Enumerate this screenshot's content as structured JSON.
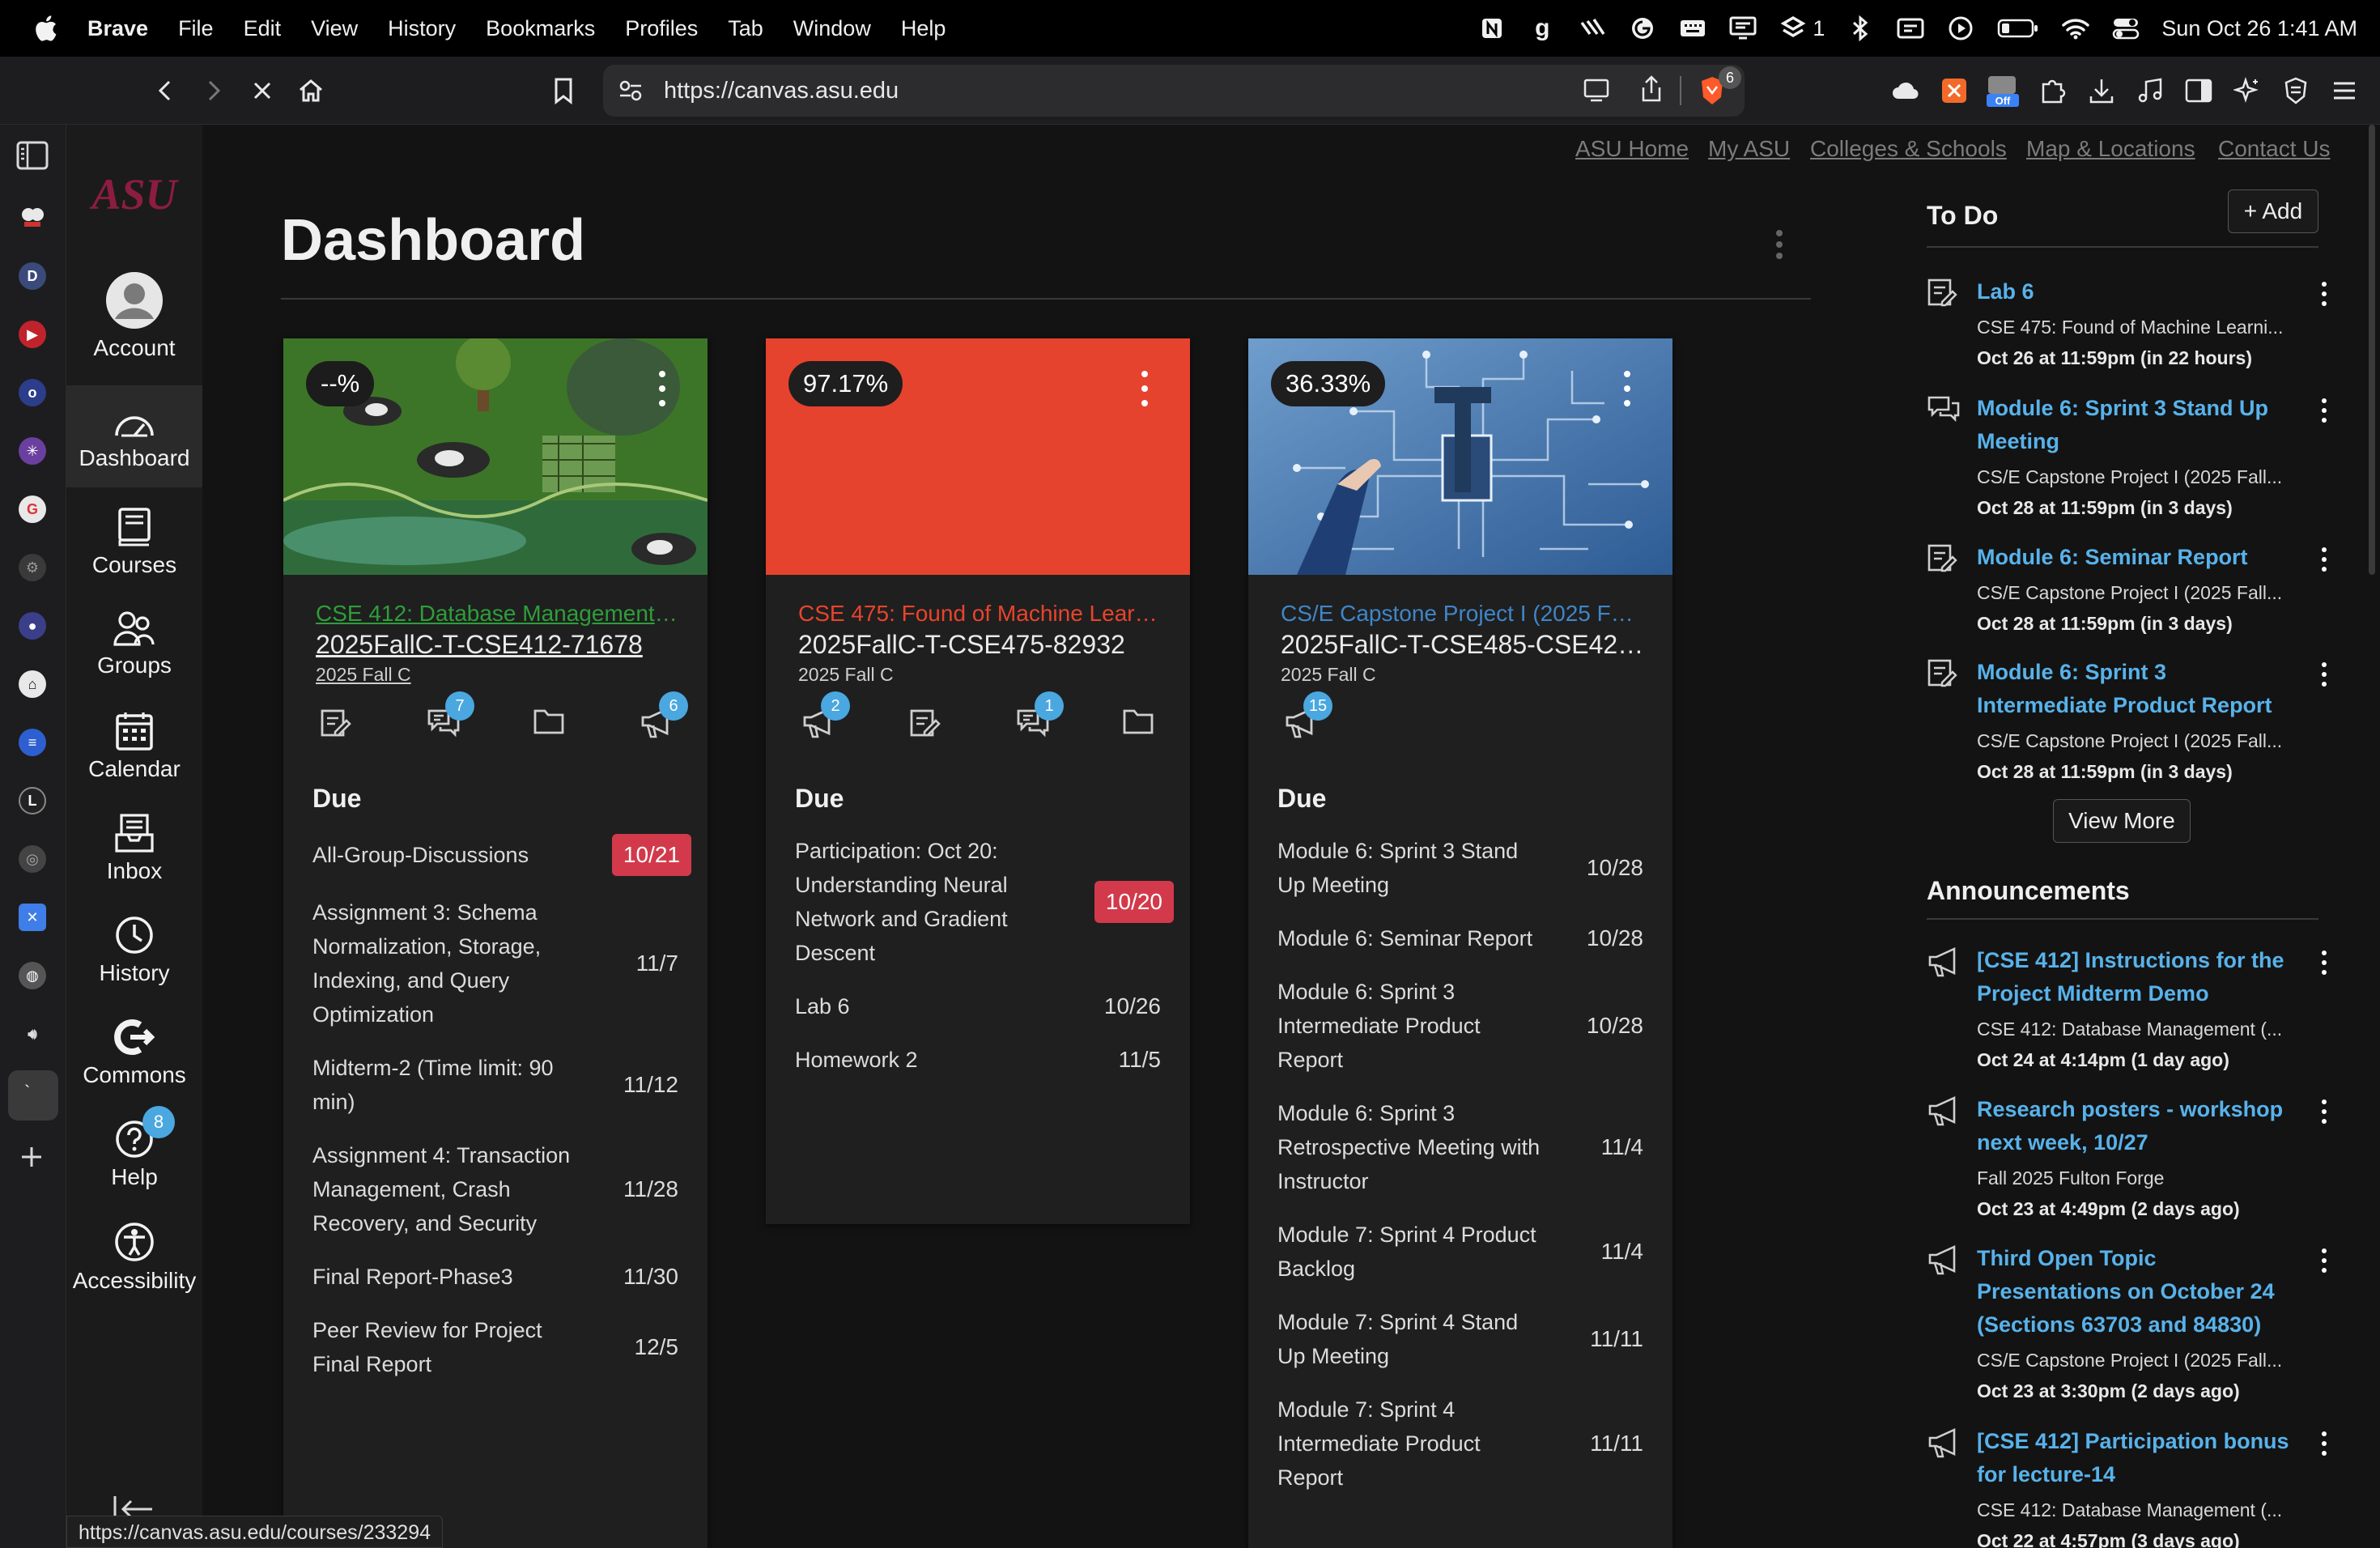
{
  "menubar": {
    "app": "Brave",
    "items": [
      "File",
      "Edit",
      "View",
      "History",
      "Bookmarks",
      "Profiles",
      "Tab",
      "Window",
      "Help"
    ],
    "status_number": "1",
    "clock": "Sun Oct 26  1:41 AM"
  },
  "toolbar": {
    "url": "https://canvas.asu.edu",
    "shields_count": "6",
    "off_badge": "Off"
  },
  "logo": {
    "text": "ASU",
    "color": "#8c1d40"
  },
  "gnav": {
    "items": [
      {
        "label": "Account",
        "icon": "account-avatar-icon"
      },
      {
        "label": "Dashboard",
        "icon": "dashboard-gauge-icon"
      },
      {
        "label": "Courses",
        "icon": "courses-book-icon"
      },
      {
        "label": "Groups",
        "icon": "groups-people-icon"
      },
      {
        "label": "Calendar",
        "icon": "calendar-icon"
      },
      {
        "label": "Inbox",
        "icon": "inbox-icon"
      },
      {
        "label": "History",
        "icon": "history-clock-icon"
      },
      {
        "label": "Commons",
        "icon": "commons-icon"
      },
      {
        "label": "Help",
        "icon": "help-icon",
        "badge": "8"
      },
      {
        "label": "Accessibility",
        "icon": "accessibility-icon"
      }
    ]
  },
  "top_links": [
    "ASU Home",
    "My ASU",
    "Colleges & Schools",
    "Map & Locations",
    "Contact Us"
  ],
  "page_title": "Dashboard",
  "cards": [
    {
      "grade": "--%",
      "title": "CSE 412: Database Management (...",
      "title_color": "#2e9e3a",
      "code": "2025FallC-T-CSE412-71678",
      "term": "2025 Fall C",
      "icons": [
        {
          "name": "assignments-icon",
          "badge": ""
        },
        {
          "name": "discussions-icon",
          "badge": "7"
        },
        {
          "name": "files-icon",
          "badge": ""
        },
        {
          "name": "announcements-icon",
          "badge": "6"
        }
      ],
      "due_heading": "Due",
      "due": [
        {
          "name": "All-Group-Discussions",
          "date": "10/21",
          "late": true
        },
        {
          "name": "Assignment 3: Schema Normalization, Storage, Indexing, and Query Optimization",
          "date": "11/7",
          "late": false
        },
        {
          "name": "Midterm-2 (Time limit: 90 min)",
          "date": "11/12",
          "late": false
        },
        {
          "name": "Assignment 4: Transaction Management, Crash Recovery, and Security",
          "date": "11/28",
          "late": false
        },
        {
          "name": "Final Report-Phase3",
          "date": "11/30",
          "late": false
        },
        {
          "name": "Peer Review for Project Final Report",
          "date": "12/5",
          "late": false
        }
      ]
    },
    {
      "grade": "97.17%",
      "title": "CSE 475: Found of Machine Learn...",
      "title_color": "#e8442c",
      "hero_color": "#e5432d",
      "code": "2025FallC-T-CSE475-82932",
      "term": "2025 Fall C",
      "icons": [
        {
          "name": "announcements-icon",
          "badge": "2"
        },
        {
          "name": "assignments-icon",
          "badge": ""
        },
        {
          "name": "discussions-icon",
          "badge": "1"
        },
        {
          "name": "files-icon",
          "badge": ""
        }
      ],
      "due_heading": "Due",
      "due": [
        {
          "name": "Participation: Oct 20: Understanding Neural Network and Gradient Descent",
          "date": "10/20",
          "late": true
        },
        {
          "name": "Lab 6",
          "date": "10/26",
          "late": false
        },
        {
          "name": "Homework 2",
          "date": "11/5",
          "late": false
        }
      ]
    },
    {
      "grade": "36.33%",
      "title": "CS/E Capstone Project I (2025 Fal...",
      "title_color": "#3f86c8",
      "code": "2025FallC-T-CSE485-CSE423-...",
      "term": "2025 Fall C",
      "icons": [
        {
          "name": "announcements-icon",
          "badge": "15"
        }
      ],
      "due_heading": "Due",
      "due": [
        {
          "name": "Module 6: Sprint 3 Stand Up Meeting",
          "date": "10/28",
          "late": false
        },
        {
          "name": "Module 6: Seminar Report",
          "date": "10/28",
          "late": false
        },
        {
          "name": "Module 6: Sprint 3 Intermediate Product Report",
          "date": "10/28",
          "late": false
        },
        {
          "name": "Module 6: Sprint 3 Retrospective Meeting with Instructor",
          "date": "11/4",
          "late": false
        },
        {
          "name": "Module 7: Sprint 4 Product Backlog",
          "date": "11/4",
          "late": false
        },
        {
          "name": "Module 7: Sprint 4 Stand Up Meeting",
          "date": "11/11",
          "late": false
        },
        {
          "name": "Module 7: Sprint 4 Intermediate Product Report",
          "date": "11/11",
          "late": false
        }
      ]
    }
  ],
  "todo": {
    "heading": "To Do",
    "add_label": "+ Add",
    "view_more": "View More",
    "items": [
      {
        "title": "Lab 6",
        "course": "CSE 475: Found of Machine Learni...",
        "date": "Oct 26 at 11:59pm (in 22 hours)",
        "icon": "assignment-icon"
      },
      {
        "title": "Module 6: Sprint 3 Stand Up Meeting",
        "course": "CS/E Capstone Project I (2025 Fall...",
        "date": "Oct 28 at 11:59pm (in 3 days)",
        "icon": "discussion-icon"
      },
      {
        "title": "Module 6: Seminar Report",
        "course": "CS/E Capstone Project I (2025 Fall...",
        "date": "Oct 28 at 11:59pm (in 3 days)",
        "icon": "assignment-icon"
      },
      {
        "title": "Module 6: Sprint 3 Intermediate Product Report",
        "course": "CS/E Capstone Project I (2025 Fall...",
        "date": "Oct 28 at 11:59pm (in 3 days)",
        "icon": "assignment-icon"
      }
    ]
  },
  "announcements": {
    "heading": "Announcements",
    "items": [
      {
        "title": "[CSE 412] Instructions for the Project Midterm Demo",
        "course": "CSE 412: Database Management (...",
        "date": "Oct 24 at 4:14pm (1 day ago)"
      },
      {
        "title": "Research posters - workshop next week, 10/27",
        "course": "Fall 2025 Fulton Forge",
        "date": "Oct 23 at 4:49pm (2 days ago)"
      },
      {
        "title": "Third Open Topic Presentations on October 24 (Sections 63703 and 84830)",
        "course": "CS/E Capstone Project I (2025 Fall...",
        "date": "Oct 23 at 3:30pm (2 days ago)"
      },
      {
        "title": "[CSE 412] Participation bonus for lecture-14",
        "course": "CSE 412: Database Management (...",
        "date": "Oct 22 at 4:57pm (3 days ago)"
      }
    ]
  },
  "status_bar_url": "https://canvas.asu.edu/courses/233294",
  "colors": {
    "link_blue": "#58b2ea",
    "late_red": "#d23a4b",
    "badge_blue": "#4aa7e0"
  }
}
